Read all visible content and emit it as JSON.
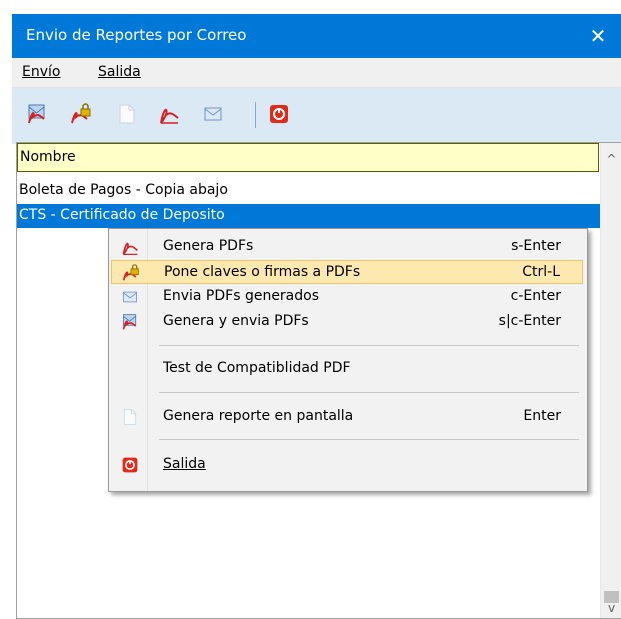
{
  "window": {
    "title": "Envio de Reportes por Correo",
    "close_glyph": "✕"
  },
  "menubar": {
    "items": [
      {
        "label": "Envío"
      },
      {
        "label": "Salida"
      }
    ]
  },
  "toolbar": {
    "buttons": [
      {
        "icon": "generate-send-pdf-icon"
      },
      {
        "icon": "lock-pdf-icon"
      },
      {
        "icon": "blank-document-icon"
      },
      {
        "icon": "pdf-icon"
      },
      {
        "icon": "envelope-icon"
      },
      {
        "icon": "exit-icon"
      }
    ]
  },
  "list": {
    "header": "Nombre",
    "rows": [
      {
        "label": "Boleta de Pagos - Copia abajo"
      },
      {
        "label": "CTS - Certificado de Deposito",
        "selected": true
      }
    ]
  },
  "scrollbar": {
    "up_glyph": "^",
    "down_glyph": "v"
  },
  "context_menu": {
    "items": [
      {
        "label": "Genera PDFs",
        "shortcut": "s-Enter",
        "icon": "pdf-icon"
      },
      {
        "label": "Pone claves o firmas a PDFs",
        "shortcut": "Ctrl-L",
        "icon": "lock-pdf-icon",
        "highlighted": true
      },
      {
        "label": "Envia PDFs generados",
        "shortcut": "c-Enter",
        "icon": "envelope-icon"
      },
      {
        "label": "Genera y envia PDFs",
        "shortcut": "s|c-Enter",
        "icon": "generate-send-pdf-icon"
      },
      {
        "label": "Test de Compatiblidad PDF",
        "shortcut": ""
      },
      {
        "label": "Genera reporte en pantalla",
        "shortcut": "Enter",
        "icon": "blank-document-icon"
      },
      {
        "label": "Salida",
        "shortcut": "",
        "icon": "exit-icon"
      }
    ]
  },
  "colors": {
    "title_bar": "#0078d7",
    "selection": "#0078d7",
    "header_bg": "#ffffc8",
    "toolbar_bg": "#dbe9f5",
    "highlight": "#fde9b0"
  }
}
